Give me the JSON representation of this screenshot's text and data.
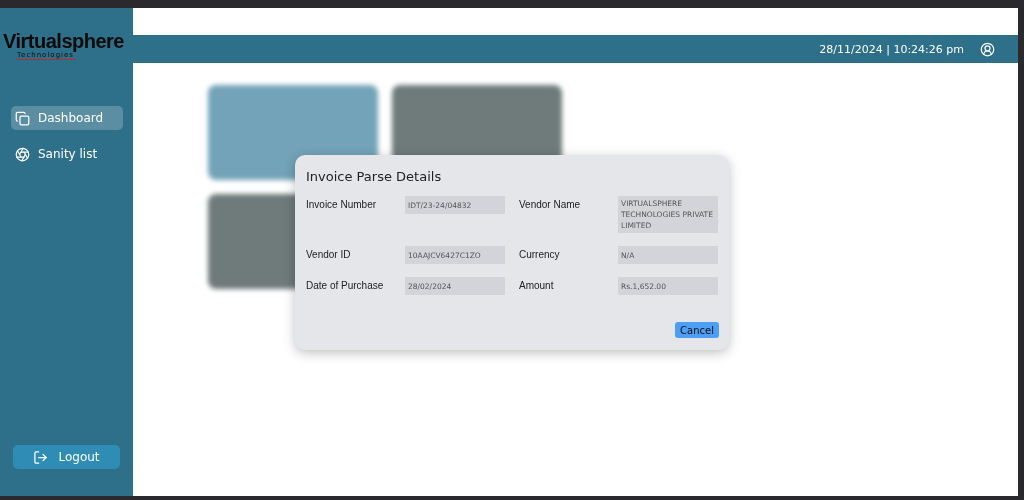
{
  "logo": {
    "name": "Virtualsphere",
    "tagline": "Technologies"
  },
  "header": {
    "datetime": "28/11/2024 | 10:24:26 pm"
  },
  "sidebar": {
    "items": [
      {
        "label": "Dashboard",
        "selected": true
      },
      {
        "label": "Sanity list",
        "selected": false
      }
    ],
    "logout": "Logout"
  },
  "dashboard": {
    "cards": [
      {
        "kind": "blue"
      },
      {
        "kind": "grey"
      },
      {
        "kind": "grey"
      }
    ]
  },
  "dialog": {
    "title": "Invoice Parse Details",
    "fields": [
      {
        "label": "Invoice Number",
        "value": "IDT/23-24/04832"
      },
      {
        "label": "Vendor Name",
        "value": "VIRTUALSPHERE TECHNOLOGIES PRIVATE LIMITED"
      },
      {
        "label": "Vendor ID",
        "value": "10AAJCV6427C1ZO"
      },
      {
        "label": "Currency",
        "value": "N/A"
      },
      {
        "label": "Date of Purchase",
        "value": "28/02/2024"
      },
      {
        "label": "Amount",
        "value": "Rs.1,652.00"
      }
    ],
    "cancel": "Cancel"
  }
}
